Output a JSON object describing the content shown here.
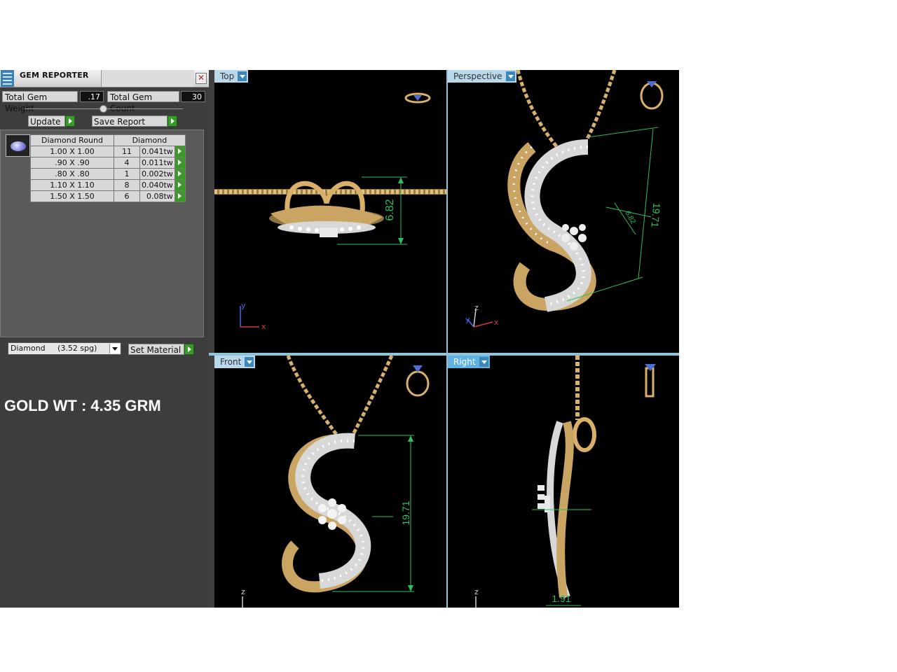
{
  "panel": {
    "title": "GEM REPORTER",
    "total_gem_weight_label": "Total Gem Weight",
    "total_gem_weight": ".17",
    "total_gem_count_label": "Total Gem Count",
    "total_gem_count": "30",
    "update_label": "Update",
    "save_report_label": "Save Report",
    "table_headers": [
      "Diamond Round",
      "Diamond"
    ],
    "rows": [
      {
        "size": "1.00 X 1.00",
        "count": "11",
        "weight": "0.041tw"
      },
      {
        "size": ".90 X .90",
        "count": "4",
        "weight": "0.011tw"
      },
      {
        "size": ".80 X .80",
        "count": "1",
        "weight": "0.002tw"
      },
      {
        "size": "1.10 X 1.10",
        "count": "8",
        "weight": "0.040tw"
      },
      {
        "size": "1.50 X 1.50",
        "count": "6",
        "weight": "0.08tw"
      }
    ],
    "material_value": "Diamond     (3.52 spg)",
    "set_material_label": "Set Material"
  },
  "gold_weight_text": "GOLD WT : 4.35 GRM",
  "viewports": {
    "top": {
      "label": "Top",
      "dimension": "6.82",
      "axis_x": "x",
      "axis_y": "y"
    },
    "perspective": {
      "label": "Perspective",
      "dimension_main": "19.71",
      "dimension_small": "6.82",
      "axis_x": "x",
      "axis_y": "y",
      "axis_z": "z"
    },
    "front": {
      "label": "Front",
      "dimension": "19.71",
      "axis_z": "z"
    },
    "right": {
      "label": "Right",
      "dimension": "1.91",
      "axis_z": "z"
    }
  },
  "colors": {
    "accent_tab": "#5fb2e2",
    "tab_inactive": "#b9d9ea",
    "measure": "#2fbf5f",
    "gold": "#d9b06a",
    "go_button": "#3a9a2a"
  }
}
